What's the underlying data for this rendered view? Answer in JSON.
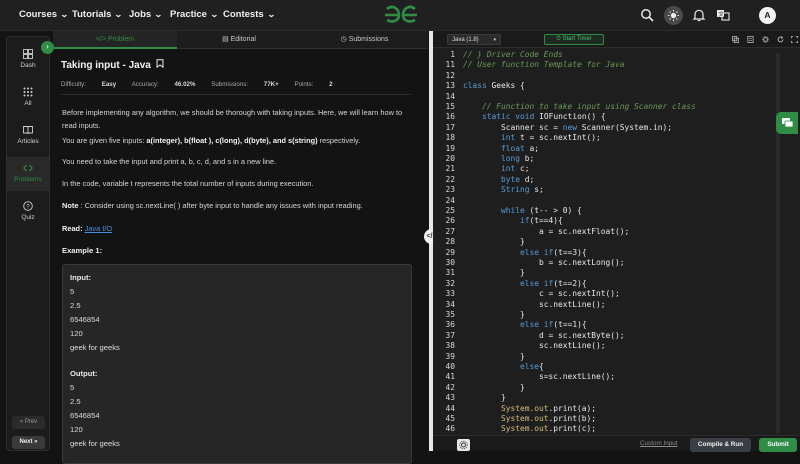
{
  "nav": {
    "items": [
      {
        "label": "Courses"
      },
      {
        "label": "Tutorials"
      },
      {
        "label": "Jobs"
      },
      {
        "label": "Practice"
      },
      {
        "label": "Contests"
      }
    ],
    "avatar": "A"
  },
  "sidebar": {
    "items": [
      {
        "label": "Dash"
      },
      {
        "label": "All"
      },
      {
        "label": "Articles"
      },
      {
        "label": "Problems"
      },
      {
        "label": "Quiz"
      }
    ],
    "prev": "« Prev",
    "next": "Next »"
  },
  "tabs": [
    "Problem",
    "Editorial",
    "Submissions"
  ],
  "problem": {
    "title": "Taking input - Java",
    "difficulty_label": "Difficulty:",
    "difficulty": "Easy",
    "accuracy_label": "Accuracy:",
    "accuracy": "46.02%",
    "submissions_label": "Submissions:",
    "submissions": "77K+",
    "points_label": "Points:",
    "points": "2",
    "p1": "Before implementing any algorithm, we should be thorough with taking inputs. Here, we will learn how to read inputs.",
    "p2_prefix": "You are given five inputs: ",
    "p2_bold": "a(integer), b(float ), c(long), d(byte), and s(string)",
    "p2_suffix": " respectively.",
    "p3": "You need to take the input and print a, b, c, d, and s in a new line.",
    "p4": "In the code, variable t represents the total number of inputs during execution.",
    "note_bold": "Note",
    "note_text": " : Consider using sc.nextLine( ) after byte input to handle any issues with input reading.",
    "read_bold": "Read:",
    "read_link": "Java I/O",
    "example_title": "Example 1:",
    "input_label": "Input:",
    "input_lines": [
      "5",
      "2.5",
      "6546854",
      "120",
      "geek  for  geeks"
    ],
    "output_label": "Output:",
    "output_lines": [
      "5",
      "2.5",
      "6546854",
      "120",
      "geek  for  geeks"
    ]
  },
  "editor": {
    "language": "Java (1.8)",
    "timer": "Start Timer",
    "custom_input": "Custom Input",
    "compile": "Compile & Run",
    "submit": "Submit",
    "code": [
      {
        "n": "1",
        "t": "// } Driver Code Ends",
        "cls": "c"
      },
      {
        "n": "11",
        "t": "// User function Template for Java",
        "cls": "c"
      },
      {
        "n": "12",
        "t": "",
        "cls": ""
      },
      {
        "n": "13",
        "t": "class Geeks {",
        "cls": ""
      },
      {
        "n": "14",
        "t": "",
        "cls": ""
      },
      {
        "n": "15",
        "t": "    // Function to take input using Scanner class",
        "cls": "c"
      },
      {
        "n": "16",
        "t": "    static void IOFunction() {",
        "cls": ""
      },
      {
        "n": "17",
        "t": "        Scanner sc = new Scanner(System.in);",
        "cls": ""
      },
      {
        "n": "18",
        "t": "        int t = sc.nextInt();",
        "cls": ""
      },
      {
        "n": "19",
        "t": "        float a;",
        "cls": ""
      },
      {
        "n": "20",
        "t": "        long b;",
        "cls": ""
      },
      {
        "n": "21",
        "t": "        int c;",
        "cls": ""
      },
      {
        "n": "22",
        "t": "        byte d;",
        "cls": ""
      },
      {
        "n": "23",
        "t": "        String s;",
        "cls": ""
      },
      {
        "n": "24",
        "t": "",
        "cls": ""
      },
      {
        "n": "25",
        "t": "        while (t-- > 0) {",
        "cls": ""
      },
      {
        "n": "26",
        "t": "            if(t==4){",
        "cls": ""
      },
      {
        "n": "27",
        "t": "                a = sc.nextFloat();",
        "cls": ""
      },
      {
        "n": "28",
        "t": "            }",
        "cls": ""
      },
      {
        "n": "29",
        "t": "            else if(t==3){",
        "cls": ""
      },
      {
        "n": "30",
        "t": "                b = sc.nextLong();",
        "cls": ""
      },
      {
        "n": "31",
        "t": "            }",
        "cls": ""
      },
      {
        "n": "32",
        "t": "            else if(t==2){",
        "cls": ""
      },
      {
        "n": "33",
        "t": "                c = sc.nextInt();",
        "cls": ""
      },
      {
        "n": "34",
        "t": "                sc.nextLine();",
        "cls": ""
      },
      {
        "n": "35",
        "t": "            }",
        "cls": ""
      },
      {
        "n": "36",
        "t": "            else if(t==1){",
        "cls": ""
      },
      {
        "n": "37",
        "t": "                d = sc.nextByte();",
        "cls": ""
      },
      {
        "n": "38",
        "t": "                sc.nextLine();",
        "cls": ""
      },
      {
        "n": "39",
        "t": "            }",
        "cls": ""
      },
      {
        "n": "40",
        "t": "            else{",
        "cls": ""
      },
      {
        "n": "41",
        "t": "                s=sc.nextLine();",
        "cls": ""
      },
      {
        "n": "42",
        "t": "            }",
        "cls": ""
      },
      {
        "n": "43",
        "t": "        }",
        "cls": ""
      },
      {
        "n": "44",
        "t": "        System.out.print(a);",
        "cls": ""
      },
      {
        "n": "45",
        "t": "        System.out.print(b);",
        "cls": ""
      },
      {
        "n": "46",
        "t": "        System.out.print(c);",
        "cls": ""
      }
    ]
  },
  "colors": {
    "accent": "#2f8d46",
    "keyword": "#569cd6",
    "comment": "#6a9955"
  }
}
